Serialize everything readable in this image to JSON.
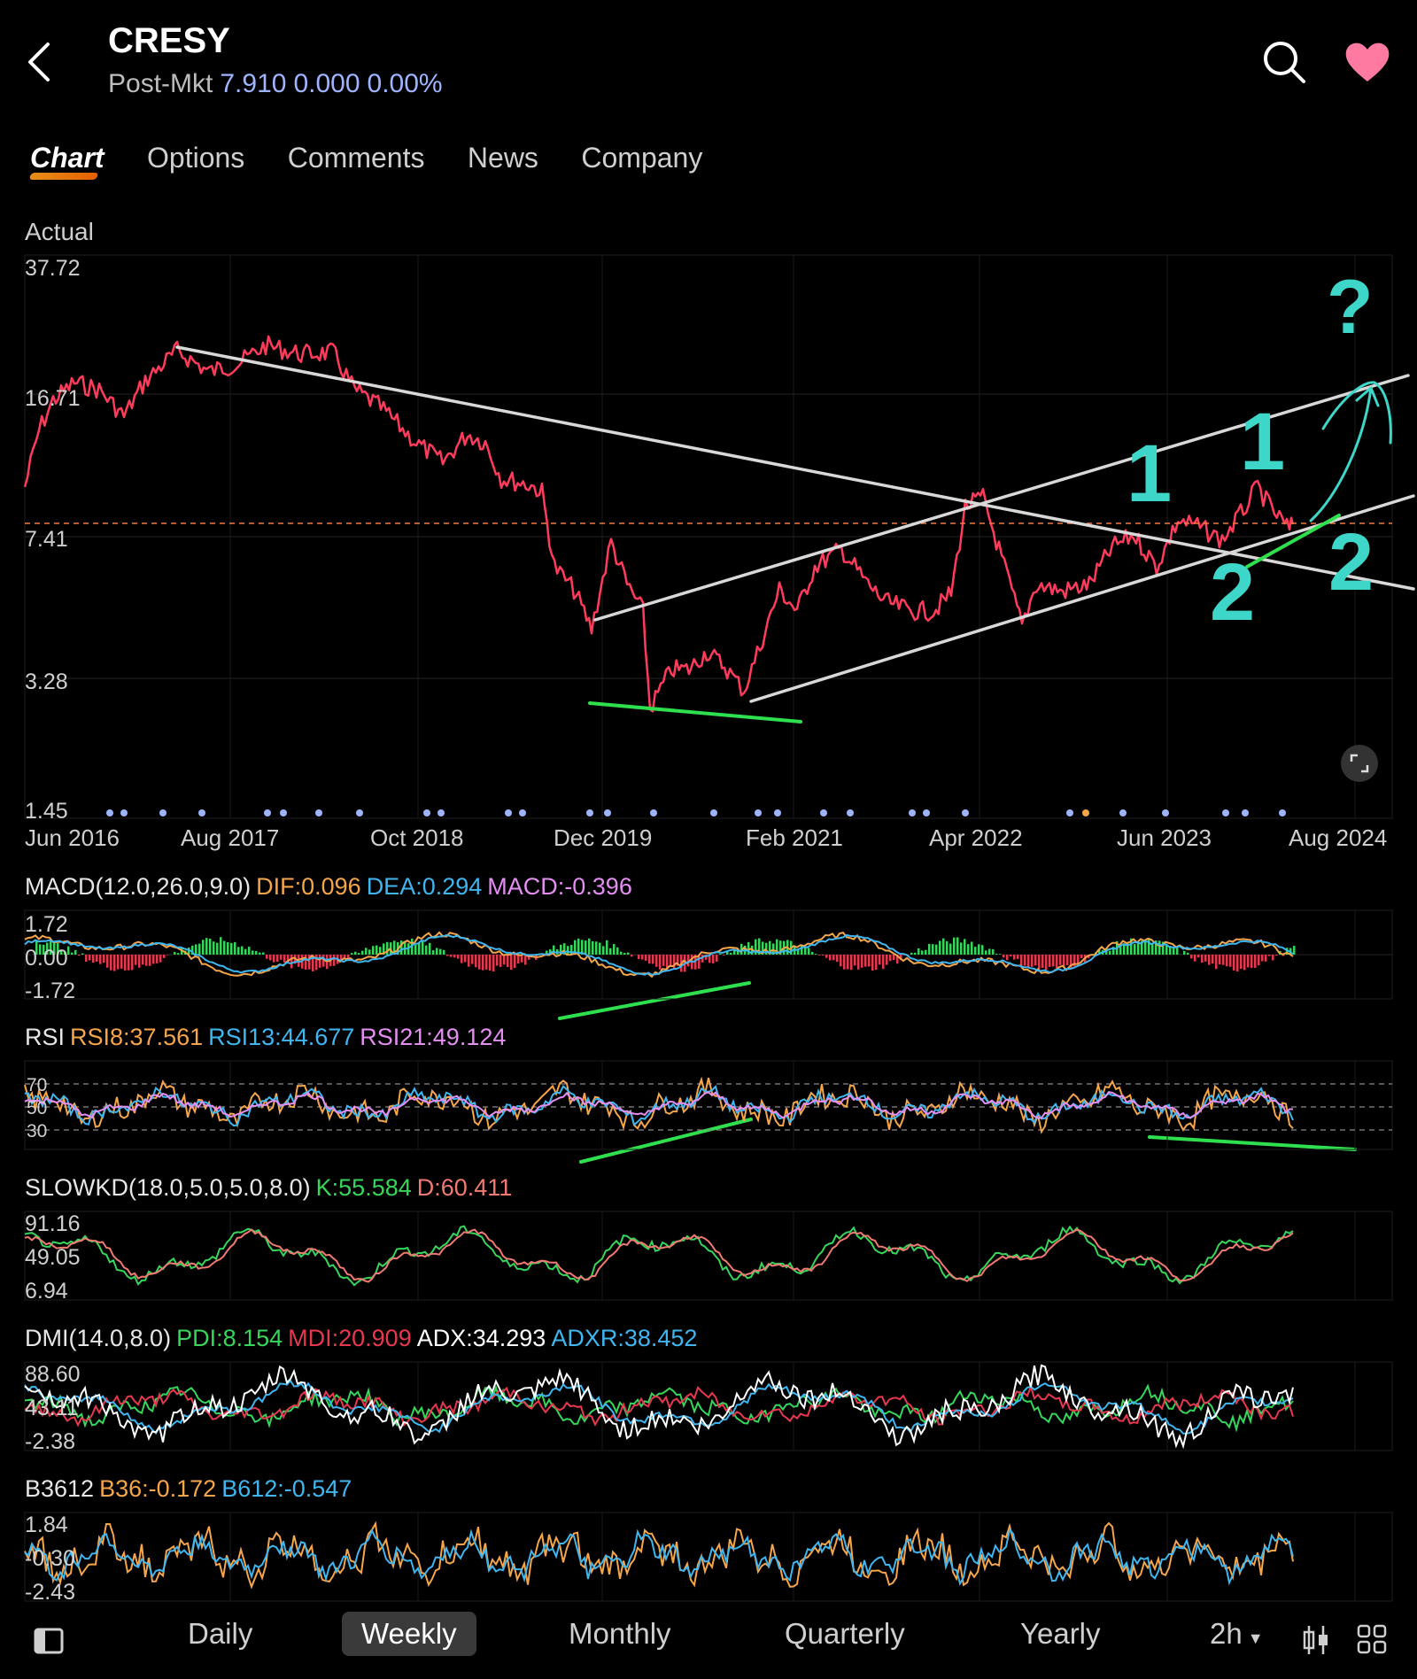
{
  "header": {
    "title": "CRESY",
    "session_label": "Post-Mkt",
    "price": "7.910",
    "change": "0.000",
    "change_pct": "0.00%",
    "back_icon": "chevron-left-icon",
    "search_icon": "search-icon",
    "favorite_icon": "heart-icon",
    "favorite_color": "#ff7aa0"
  },
  "tabs": [
    {
      "label": "Chart",
      "active": true
    },
    {
      "label": "Options",
      "active": false
    },
    {
      "label": "Comments",
      "active": false
    },
    {
      "label": "News",
      "active": false
    },
    {
      "label": "Company",
      "active": false
    }
  ],
  "main_chart": {
    "subtitle": "Actual",
    "y_labels": [
      "37.72",
      "16.71",
      "7.41",
      "3.28",
      "1.45"
    ],
    "x_labels": [
      "Jun 2016",
      "Aug 2017",
      "Oct 2018",
      "Dec 2019",
      "Feb 2021",
      "Apr 2022",
      "Jun 2023",
      "Aug 2024"
    ],
    "current_price_line": "7.91",
    "annotations": {
      "question": "?",
      "wave1a": "1",
      "wave1b": "1",
      "wave2a": "2",
      "wave2b": "2"
    },
    "expand_icon": "expand-icon",
    "line_color": "#ff3b5c",
    "annotation_color": "#3ed6c8"
  },
  "indicators": {
    "macd": {
      "name": "MACD(12.0,26.0,9.0)",
      "dif": "DIF:0.096",
      "dea": "DEA:0.294",
      "macd": "MACD:-0.396",
      "y_labels": [
        "1.72",
        "0.00",
        "-1.72"
      ]
    },
    "rsi": {
      "name": "RSI",
      "rsi8": "RSI8:37.561",
      "rsi13": "RSI13:44.677",
      "rsi21": "RSI21:49.124",
      "y_labels": [
        "70",
        "50",
        "30"
      ]
    },
    "slowkd": {
      "name": "SLOWKD(18.0,5.0,5.0,8.0)",
      "k": "K:55.584",
      "d": "D:60.411",
      "y_labels": [
        "91.16",
        "49.05",
        "6.94"
      ]
    },
    "dmi": {
      "name": "DMI(14.0,8.0)",
      "pdi": "PDI:8.154",
      "mdi": "MDI:20.909",
      "adx": "ADX:34.293",
      "adxr": "ADXR:38.452",
      "y_labels": [
        "88.60",
        "43.11",
        "-2.38"
      ]
    },
    "b3612": {
      "name": "B3612",
      "b36": "B36:-0.172",
      "b612": "B612:-0.547",
      "y_labels": [
        "1.84",
        "-0.30",
        "-2.43"
      ]
    }
  },
  "bottom_bar": {
    "sidebar_icon": "sidebar-toggle-icon",
    "periods": [
      {
        "label": "Daily",
        "active": false
      },
      {
        "label": "Weekly",
        "active": true
      },
      {
        "label": "Monthly",
        "active": false
      },
      {
        "label": "Quarterly",
        "active": false
      },
      {
        "label": "Yearly",
        "active": false
      },
      {
        "label": "2h",
        "active": false
      }
    ],
    "candle_icon": "candlestick-icon",
    "grid_icon": "grid-icon"
  },
  "colors": {
    "orange": "#f5a54a",
    "blue": "#3fb6f0",
    "pink": "#e48ef2",
    "green": "#36d65a",
    "red": "#e8384f",
    "salmon": "#f07a72",
    "white": "#ffffff"
  }
}
